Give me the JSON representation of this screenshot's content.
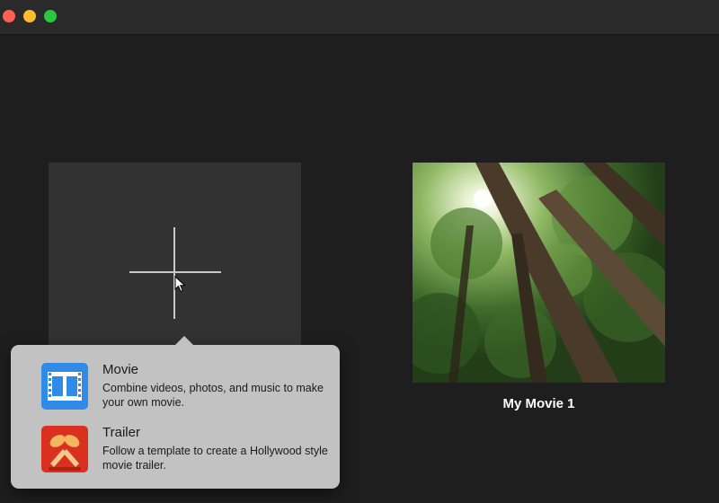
{
  "window": {
    "traffic_lights": [
      "close-button",
      "minimize-button",
      "zoom-button"
    ]
  },
  "new_project": {
    "icon": "plus-icon"
  },
  "popover": {
    "items": [
      {
        "title": "Movie",
        "description": "Combine videos, photos, and music to make your own movie.",
        "icon": "film-strip-icon",
        "color": "#2f8be6"
      },
      {
        "title": "Trailer",
        "description": "Follow a template to create a Hollywood style movie trailer.",
        "icon": "trailer-spotlight-icon",
        "color": "#d9301f"
      }
    ]
  },
  "projects": [
    {
      "title": "My Movie 1",
      "thumbnail": "forest-canopy-thumbnail"
    }
  ],
  "colors": {
    "close": "#fe5f57",
    "minimize": "#febc2e",
    "zoom": "#28c840"
  }
}
